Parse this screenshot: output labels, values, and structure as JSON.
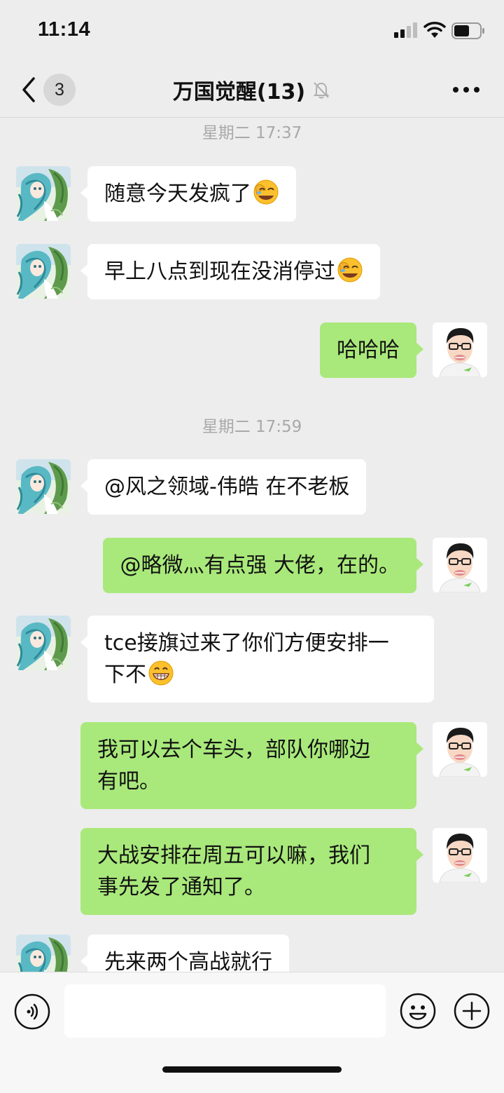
{
  "status_bar": {
    "time": "11:14"
  },
  "navbar": {
    "unread_count": "3",
    "title": "万国觉醒(13)"
  },
  "messages": [
    {
      "type": "timestamp",
      "text": "星期二 17:37"
    },
    {
      "type": "message",
      "sender": "other",
      "text": "随意今天发疯了",
      "emoji": "facepalm-laugh-emoji"
    },
    {
      "type": "message",
      "sender": "other",
      "text": "早上八点到现在没消停过",
      "emoji": "facepalm-laugh-emoji"
    },
    {
      "type": "message",
      "sender": "me",
      "text": "哈哈哈"
    },
    {
      "type": "timestamp",
      "text": "星期二 17:59"
    },
    {
      "type": "message",
      "sender": "other",
      "text": "@风之领域-伟皓 在不老板"
    },
    {
      "type": "message",
      "sender": "me",
      "text": "@略微灬有点强 大佬，在的。"
    },
    {
      "type": "message",
      "sender": "other",
      "line1": "tce接旗过来了你们方便安排一",
      "line2": "下不",
      "emoji": "grin-emoji"
    },
    {
      "type": "message",
      "sender": "me",
      "line1": "我可以去个车头，部队你哪边",
      "line2": "有吧。"
    },
    {
      "type": "message",
      "sender": "me",
      "line1": "大战安排在周五可以嘛，我们",
      "line2": "事先发了通知了。"
    },
    {
      "type": "message",
      "sender": "other",
      "text": "先来两个高战就行"
    }
  ],
  "input_bar": {
    "text_value": ""
  },
  "colors": {
    "background": "#ededed",
    "incoming_bubble": "#ffffff",
    "outgoing_bubble": "#a9e97b",
    "timestamp_text": "#a9a9a9"
  }
}
